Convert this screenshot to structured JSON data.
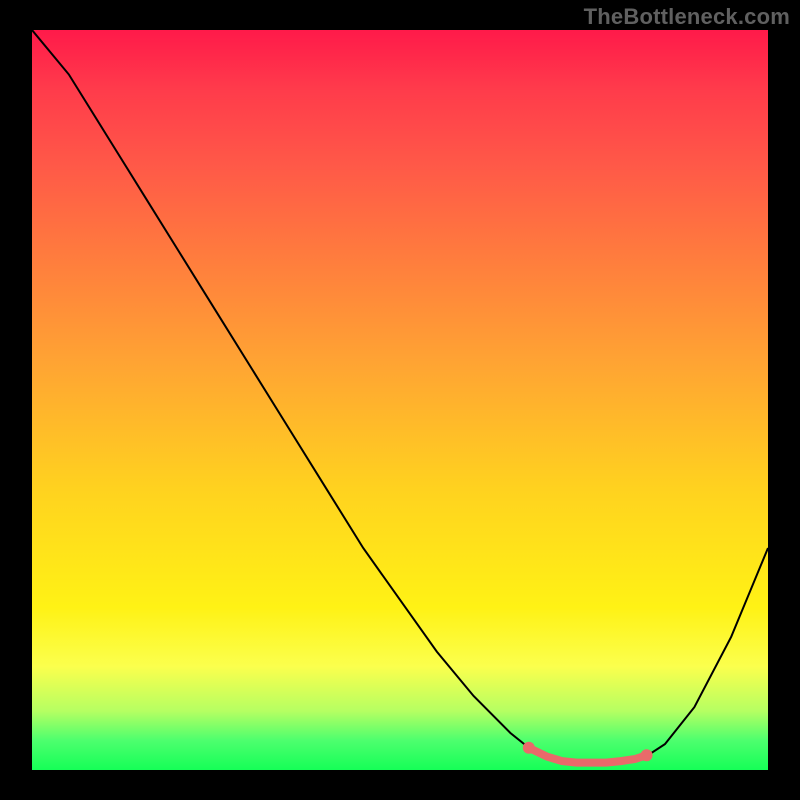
{
  "watermark": "TheBottleneck.com",
  "chart_data": {
    "type": "line",
    "title": "",
    "xlabel": "",
    "ylabel": "",
    "x": [
      0.0,
      0.05,
      0.1,
      0.15,
      0.2,
      0.25,
      0.3,
      0.35,
      0.4,
      0.45,
      0.5,
      0.55,
      0.6,
      0.65,
      0.675,
      0.7,
      0.72,
      0.74,
      0.76,
      0.78,
      0.8,
      0.82,
      0.84,
      0.86,
      0.9,
      0.95,
      1.0
    ],
    "y": [
      1.0,
      0.94,
      0.86,
      0.78,
      0.7,
      0.62,
      0.54,
      0.46,
      0.38,
      0.3,
      0.23,
      0.16,
      0.1,
      0.05,
      0.03,
      0.018,
      0.012,
      0.01,
      0.01,
      0.01,
      0.012,
      0.015,
      0.022,
      0.035,
      0.085,
      0.18,
      0.3
    ],
    "xlim": [
      0,
      1
    ],
    "ylim": [
      0,
      1
    ],
    "highlight_segment": {
      "x": [
        0.675,
        0.7,
        0.72,
        0.74,
        0.76,
        0.78,
        0.8,
        0.82,
        0.835
      ],
      "y": [
        0.03,
        0.018,
        0.012,
        0.01,
        0.01,
        0.01,
        0.012,
        0.015,
        0.02
      ]
    },
    "markers": [
      {
        "x": 0.675,
        "y": 0.03
      },
      {
        "x": 0.835,
        "y": 0.02
      }
    ],
    "background_gradient": {
      "top": "#ff1a4a",
      "mid": "#ffd21f",
      "bottom": "#15ff57"
    }
  }
}
